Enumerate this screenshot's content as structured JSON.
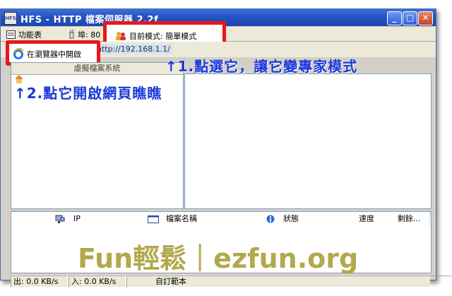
{
  "window": {
    "title": "HFS - HTTP 檔案伺服器 2.2f",
    "app_icon_text": "HFS"
  },
  "menubar": {
    "menu": "功能表",
    "port": "埠: 80",
    "mode": "目前模式: 簡單模式"
  },
  "urlbar": {
    "open_in_browser": "在瀏覽器中開啟",
    "url": "http://192.168.1.1/"
  },
  "vfs": {
    "header": "虛擬檔案系統"
  },
  "connections": {
    "columns": [
      "IP",
      "檔案名稱",
      "狀態",
      "速度",
      "剩餘..."
    ]
  },
  "statusbar": {
    "out": "出: 0.0 KB/s",
    "in": "入: 0.0 KB/s",
    "custom_template": "自訂範本"
  },
  "annotations": {
    "step1": "↑1.點選它，讓它變專家模式",
    "step2": "↑2.點它開啟網頁瞧瞧",
    "watermark": "Fun輕鬆｜ezfun.org"
  },
  "colors": {
    "highlight": "#e8161b",
    "annotation": "#1b39d9",
    "watermark": "#a59a2e"
  }
}
